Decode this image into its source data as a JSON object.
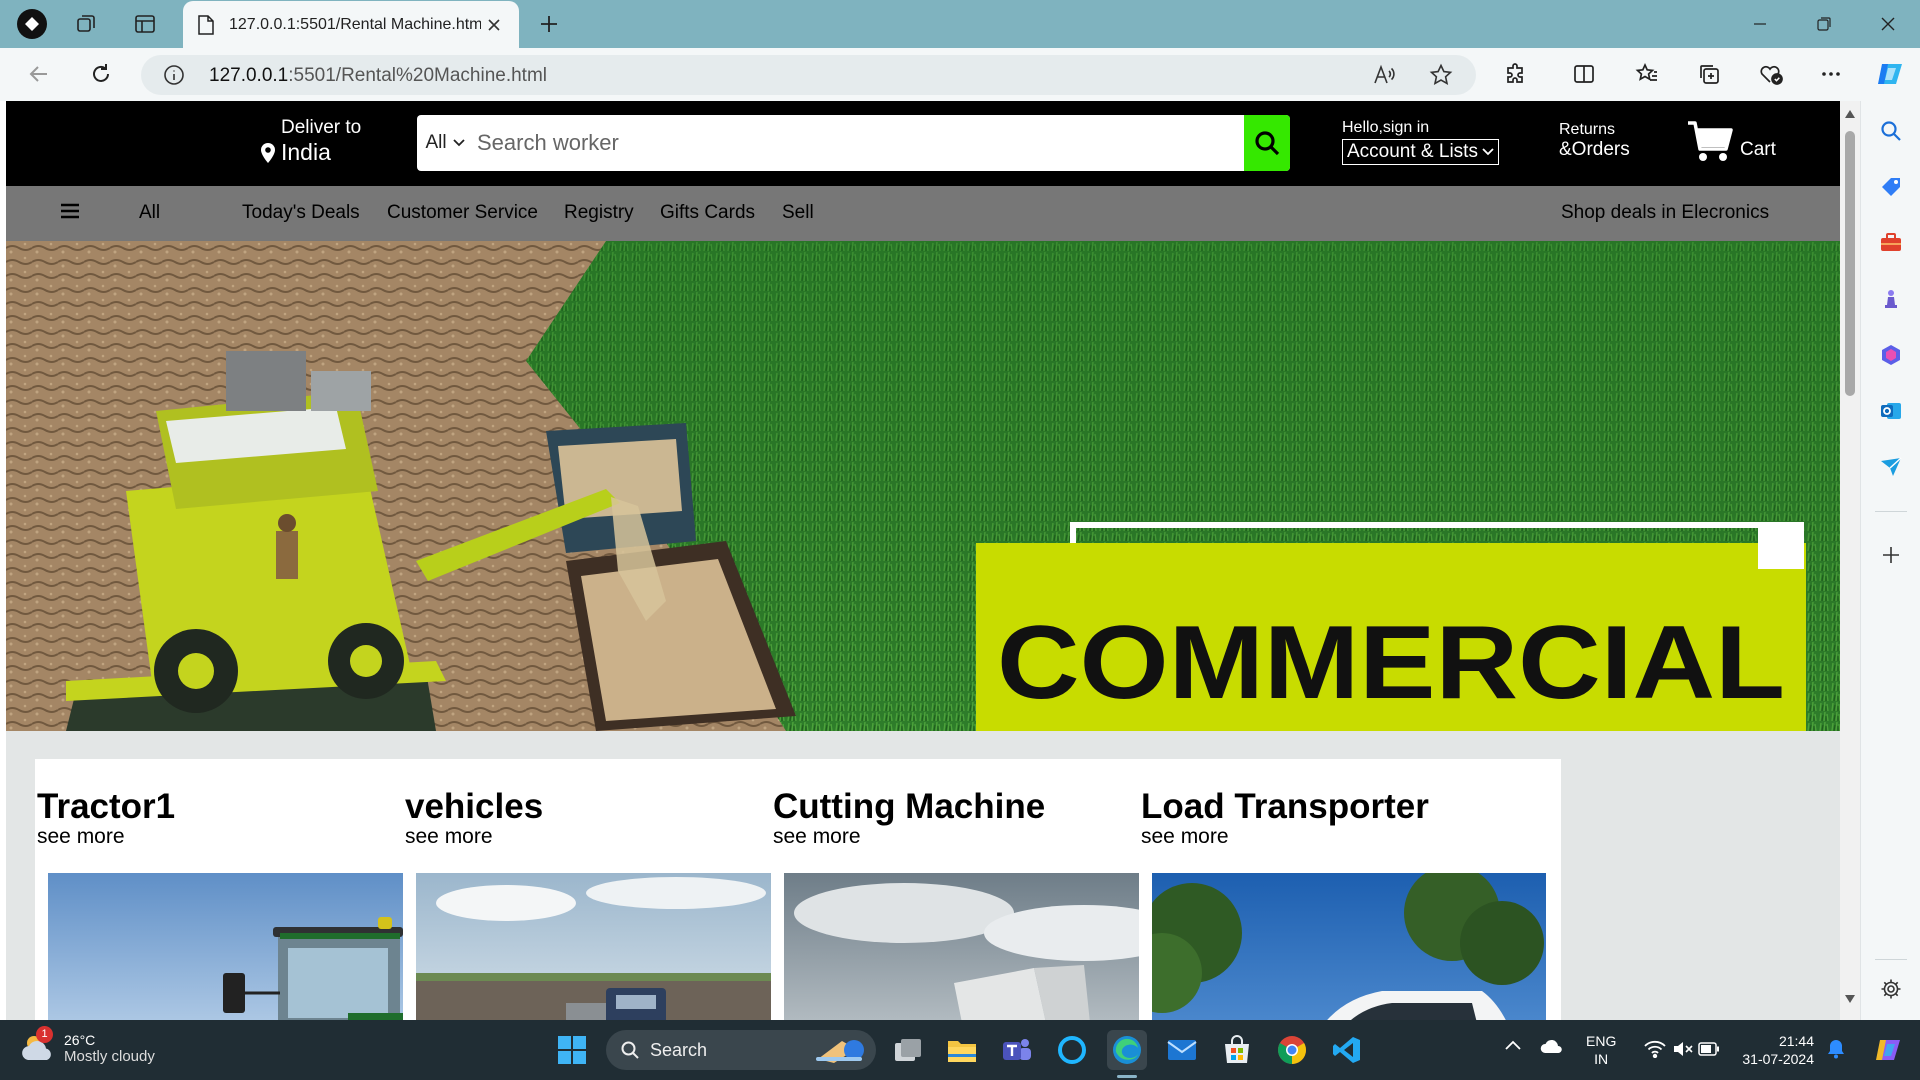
{
  "browser": {
    "tab_title": "127.0.0.1:5501/Rental Machine.html",
    "url_host": "127.0.0.1",
    "url_rest": ":5501/Rental%20Machine.html"
  },
  "site": {
    "deliver_label": "Deliver to",
    "deliver_country": "India",
    "search_category": "All",
    "search_placeholder": "Search worker",
    "greeting": "Hello,sign in",
    "account_lists": "Account & Lists",
    "returns_line1": "Returns",
    "returns_line2": "&Orders",
    "cart_label": "Cart",
    "accent_color": "#35e800"
  },
  "nav": {
    "all": "All",
    "items": [
      "Today's Deals",
      "Customer Service",
      "Registry",
      "Gifts Cards",
      "Sell"
    ],
    "promo": "Shop deals in Elecronics"
  },
  "hero": {
    "banner_text": "COMMERCIAL",
    "banner_color": "#c8dc00"
  },
  "cards": [
    {
      "title": "Tractor1",
      "link": "see more"
    },
    {
      "title": "vehicles",
      "link": "see more"
    },
    {
      "title": "Cutting Machine",
      "link": "see more"
    },
    {
      "title": "Load Transporter",
      "link": "see more"
    }
  ],
  "taskbar": {
    "weather_badge": "1",
    "weather_temp": "26°C",
    "weather_desc": "Mostly cloudy",
    "search_label": "Search",
    "lang_line1": "ENG",
    "lang_line2": "IN",
    "time": "21:44",
    "date": "31-07-2024"
  }
}
